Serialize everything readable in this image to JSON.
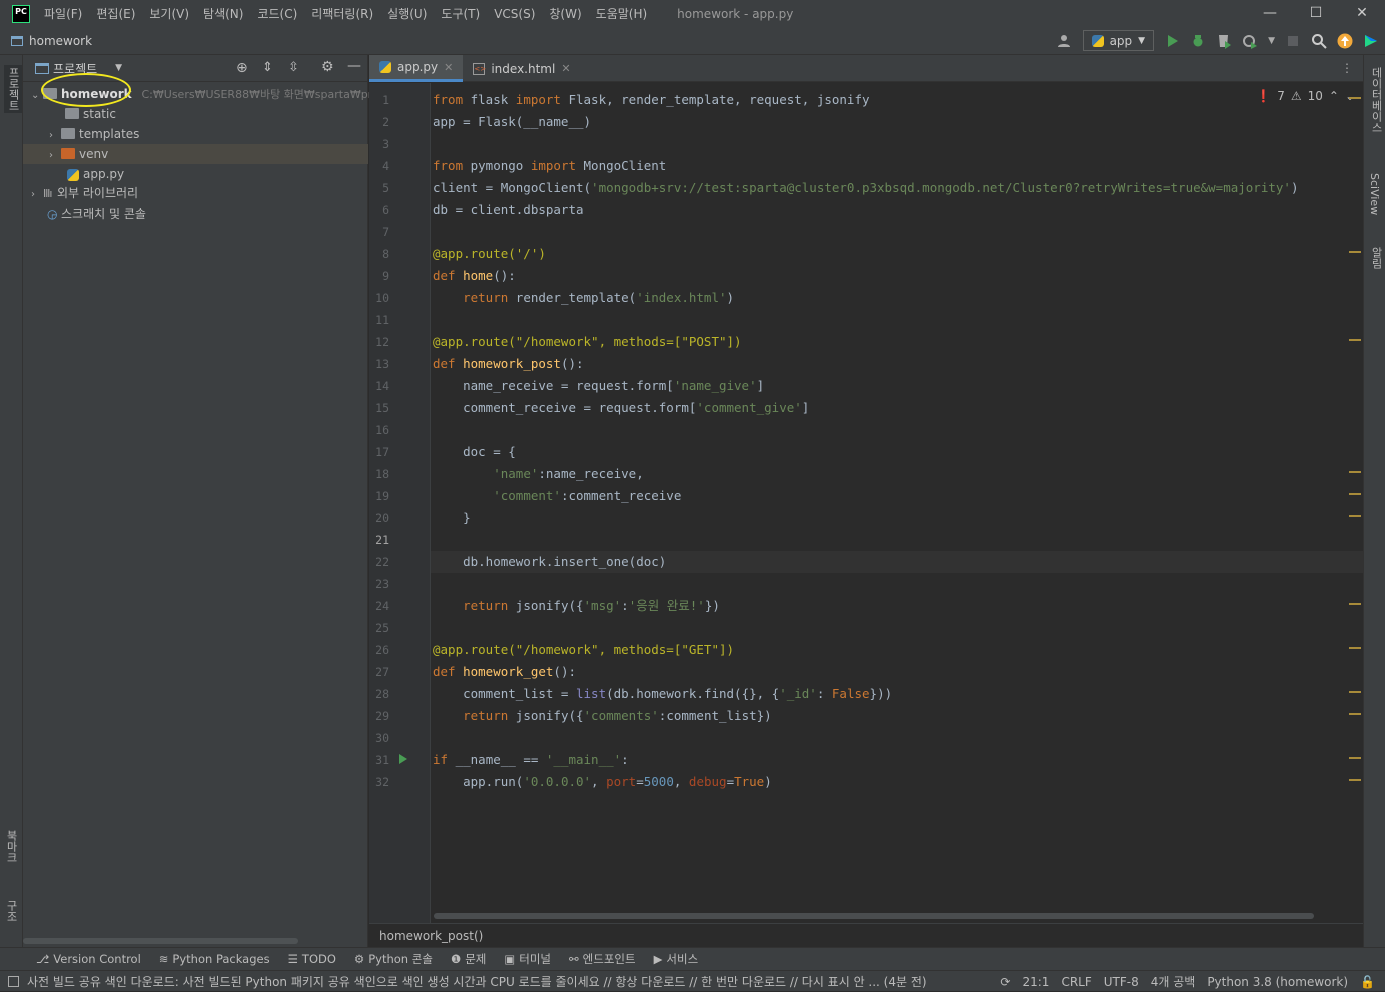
{
  "menubar": {
    "logo": "PC",
    "items": [
      "파일(F)",
      "편집(E)",
      "보기(V)",
      "탐색(N)",
      "코드(C)",
      "리팩터링(R)",
      "실행(U)",
      "도구(T)",
      "VCS(S)",
      "창(W)",
      "도움말(H)"
    ],
    "window_title": "homework - app.py",
    "controls": [
      "—",
      "☐",
      "✕"
    ]
  },
  "navbar": {
    "project": "homework",
    "run_config": "app"
  },
  "left_tabs": {
    "project": "프로젝트",
    "bookmarks": "북마크",
    "structure": "구조"
  },
  "right_tabs": {
    "database": "데이터베이스",
    "sciview": "SciView",
    "notifications": "알림"
  },
  "project_panel": {
    "title": "프로젝트",
    "tree": [
      {
        "label": "homework",
        "path": "C:₩Users₩USER88₩바탕 화면₩sparta₩proje",
        "type": "root"
      },
      {
        "label": "static",
        "type": "folder"
      },
      {
        "label": "templates",
        "type": "folder"
      },
      {
        "label": "venv",
        "type": "venv"
      },
      {
        "label": "app.py",
        "type": "file"
      },
      {
        "label": "외부 라이브러리",
        "type": "lib"
      },
      {
        "label": "스크래치 및 콘솔",
        "type": "scratch"
      }
    ]
  },
  "editor": {
    "tabs": [
      {
        "label": "app.py",
        "active": true
      },
      {
        "label": "index.html",
        "active": false
      }
    ],
    "inspections": {
      "errors": "7",
      "warnings": "10"
    },
    "breadcrumb": "homework_post()",
    "current_line": 21
  },
  "code_lines": [
    "from flask import Flask, render_template, request, jsonify",
    "app = Flask(__name__)",
    "",
    "from pymongo import MongoClient",
    "client = MongoClient('mongodb+srv://test:sparta@cluster0.p3xbsqd.mongodb.net/Cluster0?retryWrites=true&w=majority')",
    "db = client.dbsparta",
    "",
    "@app.route('/')",
    "def home():",
    "    return render_template('index.html')",
    "",
    "@app.route(\"/homework\", methods=[\"POST\"])",
    "def homework_post():",
    "    name_receive = request.form['name_give']",
    "    comment_receive = request.form['comment_give']",
    "",
    "    doc = {",
    "        'name':name_receive,",
    "        'comment':comment_receive",
    "    }",
    "",
    "    db.homework.insert_one(doc)",
    "",
    "    return jsonify({'msg':'응원 완료!'})",
    "",
    "@app.route(\"/homework\", methods=[\"GET\"])",
    "def homework_get():",
    "    comment_list = list(db.homework.find({}, {'_id': False}))",
    "    return jsonify({'comments':comment_list})",
    "",
    "if __name__ == '__main__':",
    "    app.run('0.0.0.0', port=5000, debug=True)"
  ],
  "toolstrip": [
    "Version Control",
    "Python Packages",
    "TODO",
    "Python 콘솔",
    "문제",
    "터미널",
    "엔드포인트",
    "서비스"
  ],
  "statusbar": {
    "message": "사전 빌드 공유 색인 다운로드: 사전 빌드된 Python 패키지 공유 색인으로 색인 생성 시간과 CPU 로드를 줄이세요 // 항상 다운로드 // 한 번만 다운로드 // 다시 표시 안 ... (4분 전)",
    "position": "21:1",
    "line_sep": "CRLF",
    "encoding": "UTF-8",
    "indent": "4개 공백",
    "interpreter": "Python 3.8 (homework)"
  },
  "colors": {
    "keyword": "#cc7832",
    "string": "#6a8759",
    "decorator": "#bbb529",
    "function": "#ffc66d",
    "number": "#6897bb",
    "accent": "#4a88c7",
    "highlight": "#f2e81f"
  }
}
